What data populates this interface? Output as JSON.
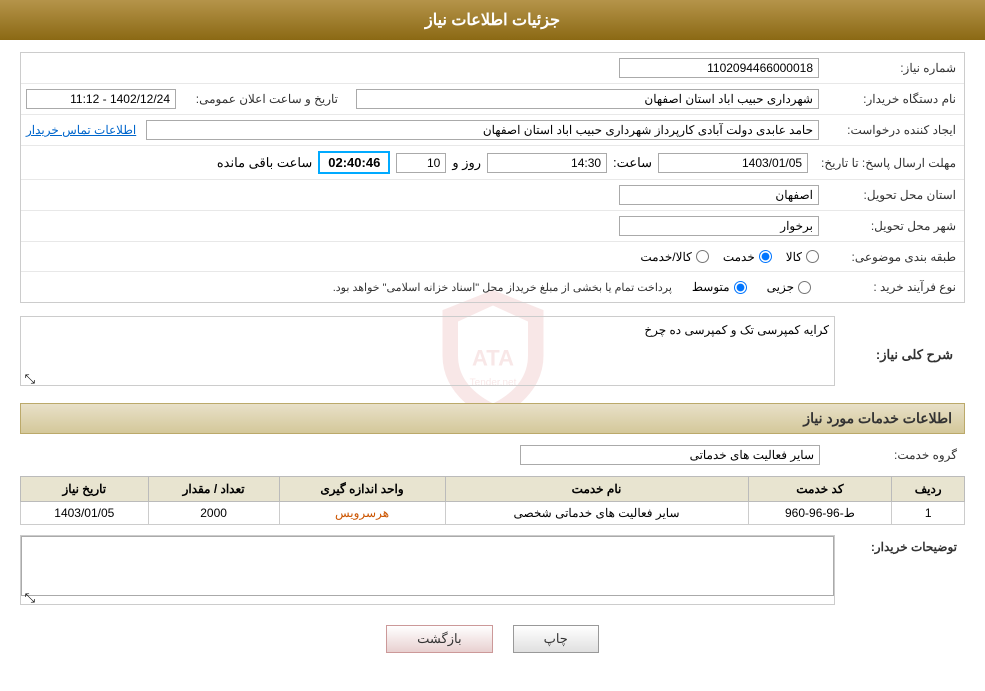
{
  "header": {
    "title": "جزئیات اطلاعات نیاز"
  },
  "fields": {
    "need_number_label": "شماره نیاز:",
    "need_number_value": "1102094466000018",
    "buyer_org_label": "نام دستگاه خریدار:",
    "buyer_org_value": "شهرداری حبیب اباد استان اصفهان",
    "announcement_date_label": "تاریخ و ساعت اعلان عمومی:",
    "announcement_date_value": "1402/12/24 - 11:12",
    "requester_label": "ایجاد کننده درخواست:",
    "requester_value": "حامد عابدی دولت آبادی کارپرداز شهرداری حبیب اباد استان اصفهان",
    "contact_link": "اطلاعات تماس خریدار",
    "deadline_label": "مهلت ارسال پاسخ: تا تاریخ:",
    "deadline_date": "1403/01/05",
    "deadline_time_label": "ساعت:",
    "deadline_time": "14:30",
    "deadline_day_label": "روز و",
    "deadline_day": "10",
    "countdown_label": "ساعت باقی مانده",
    "countdown_value": "02:40:46",
    "delivery_province_label": "استان محل تحویل:",
    "delivery_province_value": "اصفهان",
    "delivery_city_label": "شهر محل تحویل:",
    "delivery_city_value": "برخوار",
    "category_label": "طبقه بندی موضوعی:",
    "category_options": [
      "کالا",
      "خدمت",
      "کالا/خدمت"
    ],
    "category_selected": "خدمت",
    "purchase_type_label": "نوع فرآیند خرید :",
    "purchase_type_options": [
      "جزیی",
      "متوسط"
    ],
    "purchase_type_selected": "متوسط",
    "purchase_note": "پرداخت تمام یا بخشی از مبلغ خریداز محل \"اسناد خزانه اسلامی\" خواهد بود.",
    "need_summary_section": "شرح کلی نیاز:",
    "need_summary_value": "کرایه کمپرسی تک و کمپرسی ده چرخ",
    "services_section": "اطلاعات خدمات مورد نیاز",
    "service_group_label": "گروه خدمت:",
    "service_group_value": "سایر فعالیت های خدماتی",
    "services_table": {
      "columns": [
        "ردیف",
        "کد خدمت",
        "نام خدمت",
        "واحد اندازه گیری",
        "تعداد / مقدار",
        "تاریخ نیاز"
      ],
      "rows": [
        {
          "row_num": "1",
          "service_code": "ط-96-96-960",
          "service_name": "سایر فعالیت های خدماتی شخصی",
          "unit": "هرسرویس",
          "quantity": "2000",
          "date_needed": "1403/01/05"
        }
      ]
    },
    "buyer_description_label": "توضیحات خریدار:",
    "buyer_description_value": ""
  },
  "buttons": {
    "print_label": "چاپ",
    "back_label": "بازگشت"
  },
  "colors": {
    "header_bg": "#8b6914",
    "section_title_bg": "#d4c89a",
    "orange_link": "#cc5500"
  }
}
